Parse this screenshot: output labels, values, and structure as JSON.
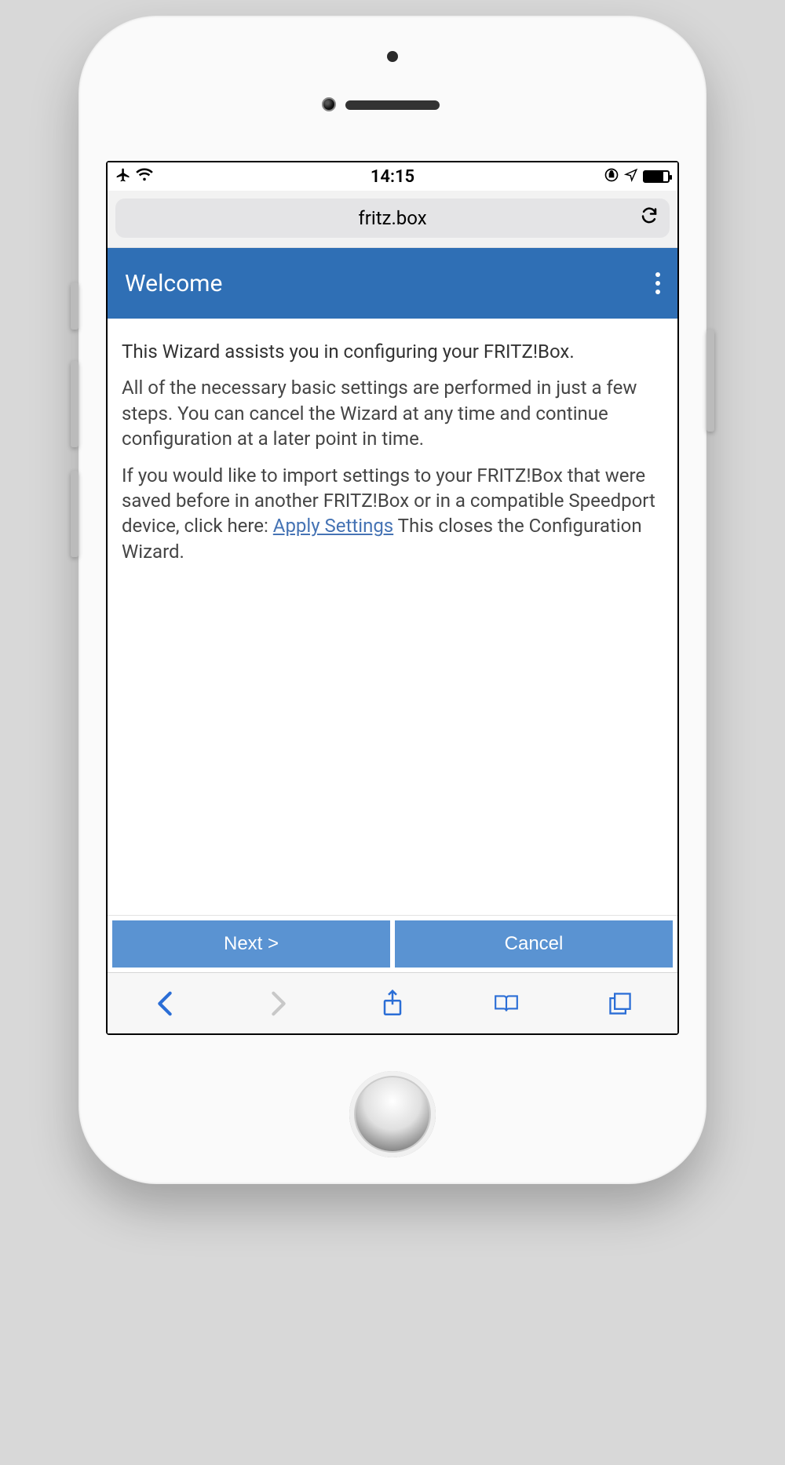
{
  "status": {
    "time": "14:15"
  },
  "browser": {
    "address": "fritz.box"
  },
  "header": {
    "title": "Welcome"
  },
  "body": {
    "p1": "This Wizard assists you in configuring your FRITZ!Box.",
    "p2": "All of the necessary basic settings are performed in just a few steps. You can cancel the Wizard at any time and continue configuration at a later point in time.",
    "p3a": "If you would like to import settings to your FRITZ!Box that were saved before in another FRITZ!Box or in a compatible Speedport device, click here: ",
    "p3link": "Apply Settings",
    "p3b": " This closes the Configuration Wizard."
  },
  "buttons": {
    "next": "Next >",
    "cancel": "Cancel"
  }
}
